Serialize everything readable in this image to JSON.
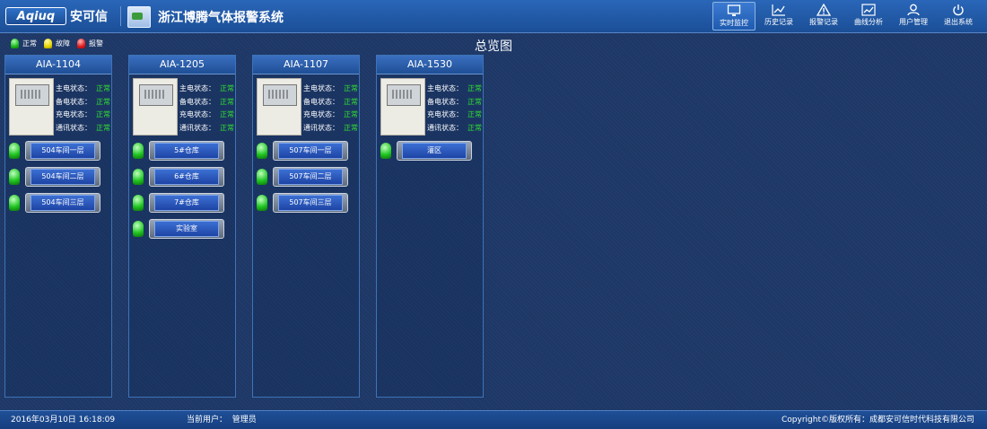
{
  "header": {
    "logo_text": "Aqiuq",
    "logo_cn": "安可信",
    "system_title": "浙江博腾气体报警系统"
  },
  "nav": [
    {
      "label": "实时监控",
      "icon": "monitor-icon"
    },
    {
      "label": "历史记录",
      "icon": "line-chart-icon"
    },
    {
      "label": "报警记录",
      "icon": "warning-icon"
    },
    {
      "label": "曲线分析",
      "icon": "curve-chart-icon"
    },
    {
      "label": "用户管理",
      "icon": "user-icon"
    },
    {
      "label": "退出系统",
      "icon": "power-icon"
    }
  ],
  "legend": [
    {
      "label": "正常",
      "color": "#1db81d"
    },
    {
      "label": "故障",
      "color": "#e6d400"
    },
    {
      "label": "报警",
      "color": "#e21b1b"
    }
  ],
  "page_title": "总览图",
  "status_labels": [
    "主电状态：",
    "备电状态：",
    "充电状态：",
    "通讯状态："
  ],
  "panels": [
    {
      "name": "AIA-1104",
      "statuses": [
        "正常",
        "正常",
        "正常",
        "正常"
      ],
      "zones": [
        "504车间一层",
        "504车间二层",
        "504车间三层"
      ]
    },
    {
      "name": "AIA-1205",
      "statuses": [
        "正常",
        "正常",
        "正常",
        "正常"
      ],
      "zones": [
        "5#仓库",
        "6#仓库",
        "7#仓库",
        "实验室"
      ]
    },
    {
      "name": "AIA-1107",
      "statuses": [
        "正常",
        "正常",
        "正常",
        "正常"
      ],
      "zones": [
        "507车间一层",
        "507车间二层",
        "507车间三层"
      ]
    },
    {
      "name": "AIA-1530",
      "statuses": [
        "正常",
        "正常",
        "正常",
        "正常"
      ],
      "zones": [
        "灌区"
      ]
    }
  ],
  "footer": {
    "datetime": "2016年03月10日 16:18:09",
    "current_user_label": "当前用户：",
    "current_user": "管理员",
    "copyright": "Copyright©版权所有：成都安可信时代科技有限公司"
  }
}
